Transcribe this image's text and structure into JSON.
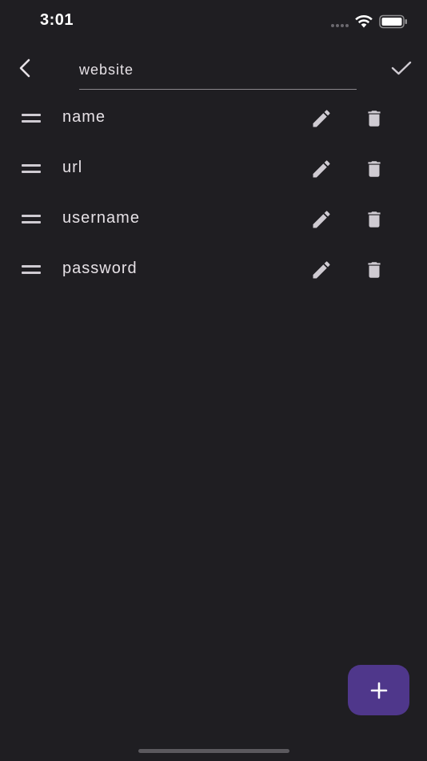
{
  "status_bar": {
    "time": "3:01",
    "icons": [
      "signal-dots-icon",
      "wifi-icon",
      "battery-icon"
    ]
  },
  "app_bar": {
    "back_icon": "chevron-left-icon",
    "title_value": "website",
    "confirm_icon": "check-icon"
  },
  "fields": [
    {
      "label": "name",
      "handle_icon": "drag-handle-icon",
      "edit_icon": "pencil-icon",
      "delete_icon": "trash-icon"
    },
    {
      "label": "url",
      "handle_icon": "drag-handle-icon",
      "edit_icon": "pencil-icon",
      "delete_icon": "trash-icon"
    },
    {
      "label": "username",
      "handle_icon": "drag-handle-icon",
      "edit_icon": "pencil-icon",
      "delete_icon": "trash-icon"
    },
    {
      "label": "password",
      "handle_icon": "drag-handle-icon",
      "edit_icon": "pencil-icon",
      "delete_icon": "trash-icon"
    }
  ],
  "fab": {
    "icon": "plus-icon"
  },
  "colors": {
    "background": "#1f1e22",
    "text": "#e6e1e6",
    "icon": "#cfcbd2",
    "fab": "#4f378b",
    "underline": "#8a878c"
  }
}
